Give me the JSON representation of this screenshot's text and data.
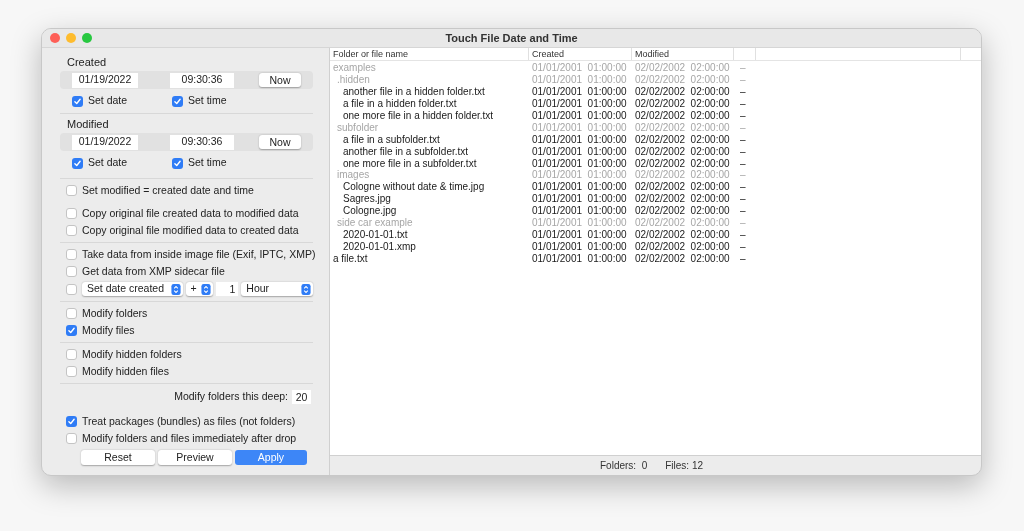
{
  "window": {
    "title": "Touch File Date and Time"
  },
  "created": {
    "label": "Created",
    "date": "01/19/2022",
    "time": "09:30:36",
    "now_button": "Now",
    "set_date": {
      "label": "Set date",
      "checked": true
    },
    "set_time": {
      "label": "Set time",
      "checked": true
    }
  },
  "modified": {
    "label": "Modified",
    "date": "01/19/2022",
    "time": "09:30:36",
    "now_button": "Now",
    "set_date": {
      "label": "Set date",
      "checked": true
    },
    "set_time": {
      "label": "Set time",
      "checked": true
    }
  },
  "options": [
    {
      "kind": "divider"
    },
    {
      "kind": "checkbox",
      "label": "Set modified = created date and time",
      "checked": false
    },
    {
      "kind": "gap"
    },
    {
      "kind": "checkbox",
      "label": "Copy original file created data to modified data",
      "checked": false
    },
    {
      "kind": "checkbox",
      "label": "Copy original file modified data to created data",
      "checked": false
    },
    {
      "kind": "divider"
    },
    {
      "kind": "checkbox",
      "label": "Take data from inside image file (Exif, IPTC, XMP)",
      "checked": false
    },
    {
      "kind": "checkbox",
      "label": "Get data from XMP sidecar file",
      "checked": false
    },
    {
      "kind": "offset",
      "checked": false,
      "field": "Set date created",
      "sign": "+",
      "amount": "1",
      "unit": "Hour"
    },
    {
      "kind": "divider"
    },
    {
      "kind": "checkbox",
      "label": "Modify folders",
      "checked": false
    },
    {
      "kind": "checkbox",
      "label": "Modify files",
      "checked": true
    },
    {
      "kind": "divider"
    },
    {
      "kind": "checkbox",
      "label": "Modify hidden folders",
      "checked": false
    },
    {
      "kind": "checkbox",
      "label": "Modify hidden files",
      "checked": false
    },
    {
      "kind": "divider"
    },
    {
      "kind": "depth",
      "label": "Modify folders this deep:",
      "value": "20"
    },
    {
      "kind": "gap"
    },
    {
      "kind": "checkbox",
      "label": "Treat packages (bundles) as files (not folders)",
      "checked": true
    },
    {
      "kind": "checkbox",
      "label": "Modify folders and files immediately after drop",
      "checked": false
    }
  ],
  "buttons": [
    {
      "label": "Reset",
      "default": false
    },
    {
      "label": "Preview",
      "default": false
    },
    {
      "label": "Apply",
      "default": true
    }
  ],
  "table": {
    "columns": [
      "Folder or file name",
      "Created",
      "Modified"
    ],
    "rows": [
      {
        "kind": "folder",
        "name": "examples",
        "created": "01/01/2001  01:00:00",
        "modified": "02/02/2002  02:00:00",
        "mark": "–",
        "children": [
          {
            "kind": "folder",
            "name": ".hidden",
            "created": "01/01/2001  01:00:00",
            "modified": "02/02/2002  02:00:00",
            "mark": "–",
            "children": [
              {
                "kind": "file",
                "name": "another file in a hidden folder.txt",
                "created": "01/01/2001  01:00:00",
                "modified": "02/02/2002  02:00:00",
                "mark": "–"
              },
              {
                "kind": "file",
                "name": "a file in a hidden folder.txt",
                "created": "01/01/2001  01:00:00",
                "modified": "02/02/2002  02:00:00",
                "mark": "–"
              },
              {
                "kind": "file",
                "name": "one more file in a hidden folder.txt",
                "created": "01/01/2001  01:00:00",
                "modified": "02/02/2002  02:00:00",
                "mark": "–"
              }
            ]
          },
          {
            "kind": "folder",
            "name": "subfolder",
            "created": "01/01/2001  01:00:00",
            "modified": "02/02/2002  02:00:00",
            "mark": "–",
            "children": [
              {
                "kind": "file",
                "name": "a file in a subfolder.txt",
                "created": "01/01/2001  01:00:00",
                "modified": "02/02/2002  02:00:00",
                "mark": "–"
              },
              {
                "kind": "file",
                "name": "another file in a subfolder.txt",
                "created": "01/01/2001  01:00:00",
                "modified": "02/02/2002  02:00:00",
                "mark": "–"
              },
              {
                "kind": "file",
                "name": "one more file in a subfolder.txt",
                "created": "01/01/2001  01:00:00",
                "modified": "02/02/2002  02:00:00",
                "mark": "–"
              }
            ]
          },
          {
            "kind": "folder",
            "name": "images",
            "created": "01/01/2001  01:00:00",
            "modified": "02/02/2002  02:00:00",
            "mark": "–",
            "children": [
              {
                "kind": "file",
                "name": "Cologne without date & time.jpg",
                "created": "01/01/2001  01:00:00",
                "modified": "02/02/2002  02:00:00",
                "mark": "–"
              },
              {
                "kind": "file",
                "name": "Sagres.jpg",
                "created": "01/01/2001  01:00:00",
                "modified": "02/02/2002  02:00:00",
                "mark": "–"
              },
              {
                "kind": "file",
                "name": "Cologne.jpg",
                "created": "01/01/2001  01:00:00",
                "modified": "02/02/2002  02:00:00",
                "mark": "–"
              }
            ]
          },
          {
            "kind": "folder",
            "name": "side car example",
            "created": "01/01/2001  01:00:00",
            "modified": "02/02/2002  02:00:00",
            "mark": "–",
            "children": [
              {
                "kind": "file",
                "name": "2020-01-01.txt",
                "created": "01/01/2001  01:00:00",
                "modified": "02/02/2002  02:00:00",
                "mark": "–"
              },
              {
                "kind": "file",
                "name": "2020-01-01.xmp",
                "created": "01/01/2001  01:00:00",
                "modified": "02/02/2002  02:00:00",
                "mark": "–"
              }
            ]
          }
        ]
      },
      {
        "kind": "file",
        "name": "a file.txt",
        "created": "01/01/2001  01:00:00",
        "modified": "02/02/2002  02:00:00",
        "mark": "–"
      }
    ]
  },
  "status_bar": {
    "folders": "Folders:  0",
    "files": "Files: 12"
  }
}
